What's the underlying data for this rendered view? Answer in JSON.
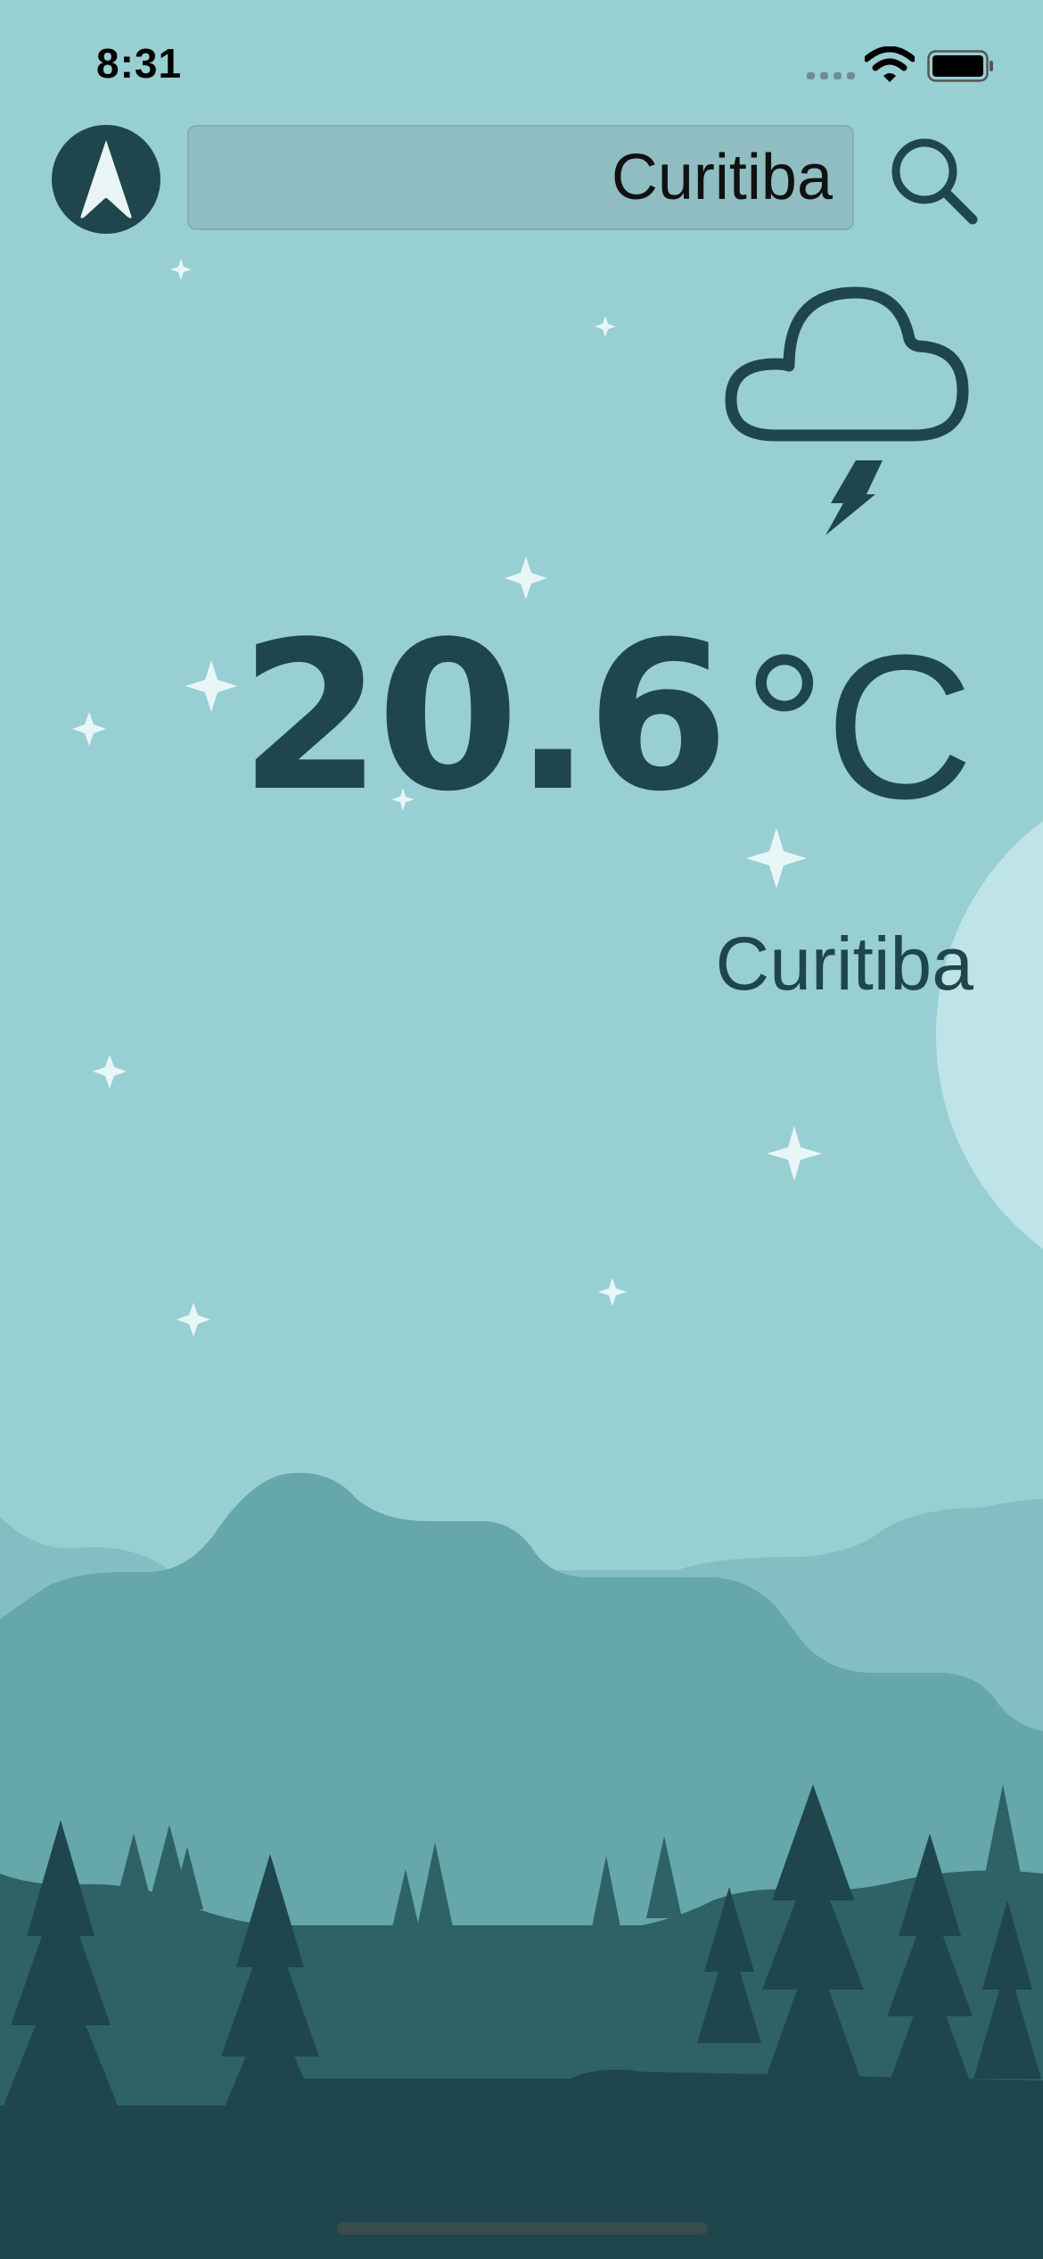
{
  "status_bar": {
    "time": "8:31"
  },
  "search": {
    "value": "Curitiba"
  },
  "weather": {
    "condition_icon": "cloud-lightning-icon",
    "temperature": "20.6",
    "unit": "°C",
    "city": "Curitiba"
  },
  "colors": {
    "sky": "#98cfd3",
    "accent_dark": "#1e464c",
    "mountain_far": "#82bec2",
    "mountain_mid": "#65a7ab",
    "hill": "#2e6265",
    "ground": "#1e464c"
  }
}
